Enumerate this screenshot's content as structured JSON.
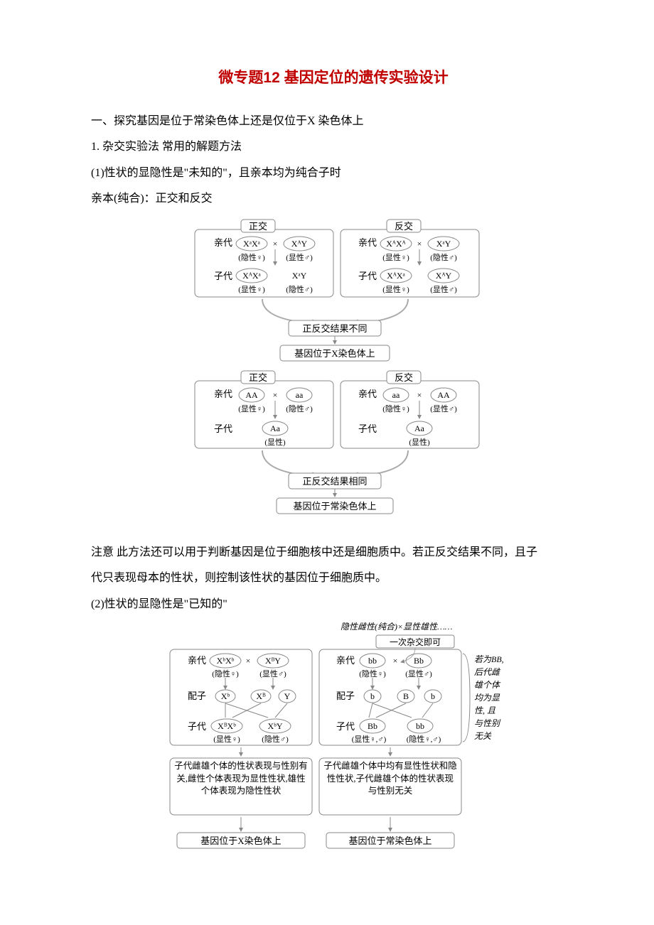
{
  "title": "微专题12   基因定位的遗传实验设计",
  "p1": "一、探究基因是位于常染色体上还是仅位于X 染色体上",
  "p2": "1. 杂交实验法   常用的解题方法",
  "p3": "(1)性状的显隐性是\"未知的\"，且亲本均为纯合子时",
  "p4": "亲本(纯合)：正交和反交",
  "fig1": {
    "zj": "正交",
    "fj": "反交",
    "qd": "亲代",
    "zd": "子代",
    "xa": "XᵃXᵃ",
    "xA_y": "XᴬY",
    "xA_xA": "XᴬXᴬ",
    "xa_y": "XᵃY",
    "xA_xa": "XᴬXᵃ",
    "yinf": "(隐性♀)",
    "xianm": "(显性♂)",
    "xianf": "(显性♀)",
    "yinm": "(隐性♂)",
    "r1": "正反交结果不同",
    "r2": "基因位于X染色体上",
    "AA": "AA",
    "aa": "aa",
    "Aa": "Aa",
    "xian": "(显性)",
    "r3": "正反交结果相同",
    "r4": "基因位于常染色体上"
  },
  "p5": "注意   此方法还可以用于判断基因是位于细胞核中还是细胞质中。若正反交结果不同，且子",
  "p5b": "代只表现母本的性状，则控制该性状的基因位于细胞质中。",
  "p6": "(2)性状的显隐性是\"已知的\"",
  "fig2": {
    "topnote": "隐性雌性(纯合)×显性雄性……",
    "topnote2": "一次杂交即可",
    "qd": "亲代",
    "pz": "配子",
    "zd": "子代",
    "Xb_Xb": "XᵇXᵇ",
    "XB_Y": "XᴮY",
    "Xb": "Xᵇ",
    "XB": "Xᴮ",
    "Y": "Y",
    "XB_Xb": "XᴮXᵇ",
    "Xb_Y": "XᵇY",
    "bb": "bb",
    "Bb": "Bb",
    "b": "b",
    "B": "B",
    "yinf": "(隐性♀)",
    "xianm": "(显性♂)",
    "xianf": "(显性♀)",
    "yinm": "(隐性♂)",
    "xianfm": "(显性♀,♂)",
    "yinfm": "(隐性♀,♂)",
    "side": [
      "若为BB,",
      "后代雌",
      "雄个体",
      "均为显",
      "性, 且",
      "与性别",
      "无关"
    ],
    "box_l": "子代雌雄个体的性状表现与性别有关,雌性个体表现为显性性状,雄性个体表现为隐性性状",
    "box_r": "子代雌雄个体中均有显性性状和隐性性状,子代雌雄个体的性状表现与性别无关",
    "c1": "基因位于X染色体上",
    "c2": "基因位于常染色体上"
  }
}
